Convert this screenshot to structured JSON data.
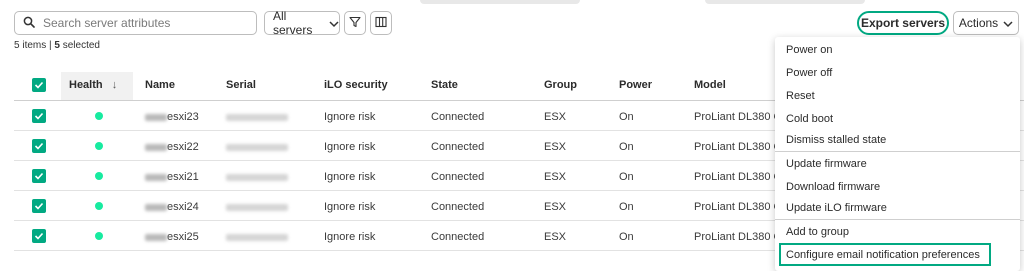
{
  "toolbar": {
    "search_placeholder": "Search server attributes",
    "filter_select_value": "All servers",
    "export_label": "Export servers",
    "actions_label": "Actions"
  },
  "summary": {
    "items_count": "5",
    "items_label": "items",
    "selected_count": "5",
    "selected_label": "selected"
  },
  "table": {
    "columns": [
      "Health",
      "Name",
      "Serial",
      "iLO security",
      "State",
      "Group",
      "Power",
      "Model"
    ],
    "sort_indicator": "↓",
    "rows": [
      {
        "name": "esxi23",
        "ilo_security": "Ignore risk",
        "state": "Connected",
        "group": "ESX",
        "power": "On",
        "model": "ProLiant DL380 G"
      },
      {
        "name": "esxi22",
        "ilo_security": "Ignore risk",
        "state": "Connected",
        "group": "ESX",
        "power": "On",
        "model": "ProLiant DL380 G"
      },
      {
        "name": "esxi21",
        "ilo_security": "Ignore risk",
        "state": "Connected",
        "group": "ESX",
        "power": "On",
        "model": "ProLiant DL380 G"
      },
      {
        "name": "esxi24",
        "ilo_security": "Ignore risk",
        "state": "Connected",
        "group": "ESX",
        "power": "On",
        "model": "ProLiant DL380 G"
      },
      {
        "name": "esxi25",
        "ilo_security": "Ignore risk",
        "state": "Connected",
        "group": "ESX",
        "power": "On",
        "model": "ProLiant DL380 G"
      }
    ]
  },
  "actions_menu": {
    "items": [
      "Power on",
      "Power off",
      "Reset",
      "Cold boot",
      "Dismiss stalled state",
      "Update firmware",
      "Download firmware",
      "Update iLO firmware",
      "Add to group",
      "Configure email notification preferences"
    ]
  },
  "colors": {
    "accent": "#01a982",
    "health_ok": "#17eba0"
  },
  "icons": {
    "search": "search-icon",
    "filter": "filter-icon",
    "columns": "columns-icon",
    "chevron": "chevron-down-icon",
    "checkbox": "checkmark-icon"
  }
}
